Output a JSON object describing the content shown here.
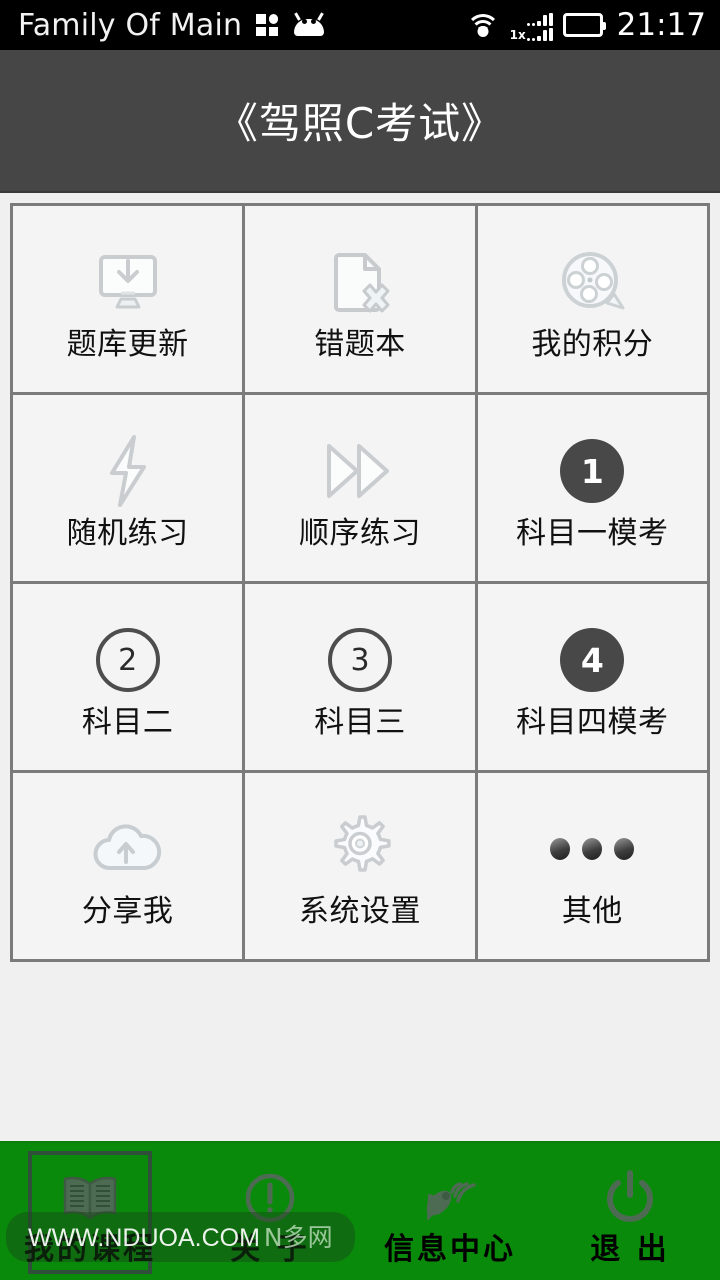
{
  "statusbar": {
    "title": "Family Of Main",
    "time": "21:17",
    "network_label": "1x",
    "icons": {
      "apps": "quad-square-icon",
      "android": "android-robot-icon",
      "wifi": "wifi-icon",
      "signal": "cellular-signal-icon",
      "battery": "battery-icon"
    },
    "battery_color": "#4fe81f"
  },
  "header": {
    "title": "《驾照C考试》",
    "background": "#464646",
    "text_color": "#ffffff"
  },
  "grid": {
    "columns": 3,
    "border_color": "#7b7b7b",
    "cell_background": "#f4f4f4",
    "items": [
      {
        "label": "题库更新",
        "icon": "monitor-download-icon",
        "icon_type": "svg"
      },
      {
        "label": "错题本",
        "icon": "document-error-icon",
        "icon_type": "svg"
      },
      {
        "label": "我的积分",
        "icon": "film-reel-icon",
        "icon_type": "svg"
      },
      {
        "label": "随机练习",
        "icon": "lightning-bolt-icon",
        "icon_type": "svg"
      },
      {
        "label": "顺序练习",
        "icon": "fast-forward-icon",
        "icon_type": "svg"
      },
      {
        "label": "科目一模考",
        "icon": "number-badge-filled",
        "icon_type": "badge-filled",
        "badge": "1"
      },
      {
        "label": "科目二",
        "icon": "number-badge-outline",
        "icon_type": "badge-outline",
        "badge": "2"
      },
      {
        "label": "科目三",
        "icon": "number-badge-outline",
        "icon_type": "badge-outline",
        "badge": "3"
      },
      {
        "label": "科目四模考",
        "icon": "number-badge-filled",
        "icon_type": "badge-filled",
        "badge": "4"
      },
      {
        "label": "分享我",
        "icon": "cloud-upload-icon",
        "icon_type": "svg"
      },
      {
        "label": "系统设置",
        "icon": "gear-icon",
        "icon_type": "svg"
      },
      {
        "label": "其他",
        "icon": "three-dots-icon",
        "icon_type": "dots"
      }
    ]
  },
  "bottom_nav": {
    "background": "#0a8a0a",
    "label_color": "#000000",
    "items": [
      {
        "label": "我的课程",
        "icon": "open-book-icon",
        "selected": true
      },
      {
        "label": "关 于",
        "icon": "info-circle-icon",
        "selected": false
      },
      {
        "label": "信息中心",
        "icon": "satellite-dish-icon",
        "selected": false
      },
      {
        "label": "退 出",
        "icon": "power-icon",
        "selected": false
      }
    ]
  },
  "watermark": {
    "url": "WWW.NDUOA.COM",
    "site": "N多网"
  }
}
